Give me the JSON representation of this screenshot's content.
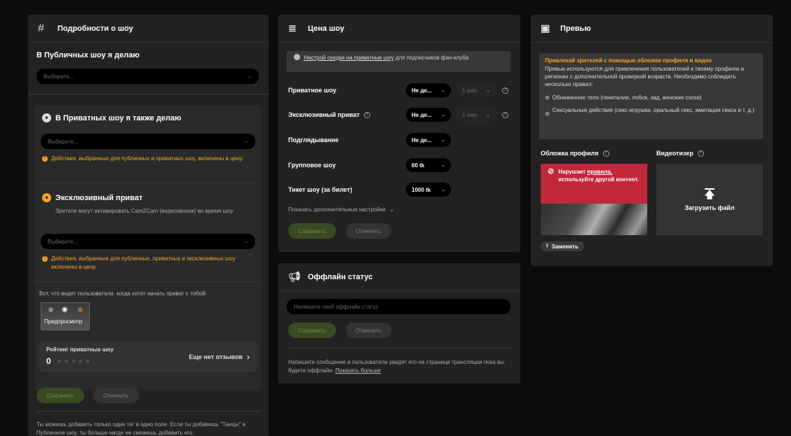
{
  "show_details": {
    "title": "Подробности о шоу",
    "public_heading": "В Публичных шоу я делаю",
    "public_placeholder": "Выберите...",
    "private_heading": "В Приватных шоу я также делаю",
    "private_placeholder": "Выберите...",
    "private_warning": "Действия, выбранные для публичных и приватных шоу, включены в цену.",
    "exclusive_heading": "Эксклюзивный приват",
    "exclusive_desc": "Зрители могут активировать Cam2Cam (видеозвонок) во время шоу.",
    "exclusive_placeholder": "Выберите...",
    "exclusive_warning": "Действия, выбранные для публичных, приватных и эксклюзивных шоу включены в цену.",
    "preview_hint": "Вот, что видят пользователи, когда хотят начать приват с тобой:",
    "preview_label": "Предпросмотр",
    "rating_title": "Рейтинг приватных шоу",
    "rating_value": "0",
    "no_reviews": "Еще нет отзывов",
    "save_label": "Сохранить",
    "cancel_label": "Отменить",
    "footer_note": "Ты можешь добавить только один тег в одно поле. Если ты добавишь \"Танцы\" в Публичное шоу, ты больше нигде не сможешь добавить его"
  },
  "price": {
    "title": "Цена шоу",
    "discount_link": "Настрой скидки на приватные шоу",
    "discount_rest": " для подписчиков фан-клуба",
    "rows": [
      {
        "label": "Приватное шоу",
        "value": "Не де...",
        "duration": "1 мин"
      },
      {
        "label": "Эксклюзивный приват",
        "value": "Не де...",
        "duration": "1 мин"
      },
      {
        "label": "Подглядывание",
        "value": "Не де..."
      },
      {
        "label": "Групповое шоу",
        "value": "60 tk"
      },
      {
        "label": "Тикет шоу (за билет)",
        "value": "1000 tk"
      }
    ],
    "more_settings": "Показать дополнительные настройки",
    "save_label": "Сохранить",
    "cancel_label": "Отменить"
  },
  "offline": {
    "title": "Оффлайн статус",
    "placeholder": "Напишите свой оффлайн статус",
    "save_label": "Сохранить",
    "cancel_label": "Отменить",
    "note": "Напишите сообщение и пользователи увидят его на странице трансляции пока вы будете оффлайн.",
    "show_more": "Показать больше"
  },
  "preview": {
    "title": "Превью",
    "info_title": "Привлекай зрителей с помощью обложки профиля и видео",
    "info_text": "Превью используются для привлечения пользователей к твоему профилю в регионах с дополнительной проверкой возраста. Необходимо соблюдать несколько правил:",
    "rule1": "Обнаженное тело (гениталии, лобок, зад, женские соски)",
    "rule2": "Сексуальные действия (секс-игрушки, оральный секс, имитация секса и т. д.)",
    "cover_title": "Обложка профиля",
    "video_title": "Видеотизер",
    "violation_pre": "Нарушает ",
    "violation_link": "правила,",
    "violation_post": " используйте другой контент.",
    "upload_label": "Загрузить файл",
    "replace_label": "Заменить"
  },
  "colors": {
    "accent": "#f5a623",
    "danger": "#c0283a",
    "save_bg": "#3a4a22",
    "panel": "#222222"
  }
}
